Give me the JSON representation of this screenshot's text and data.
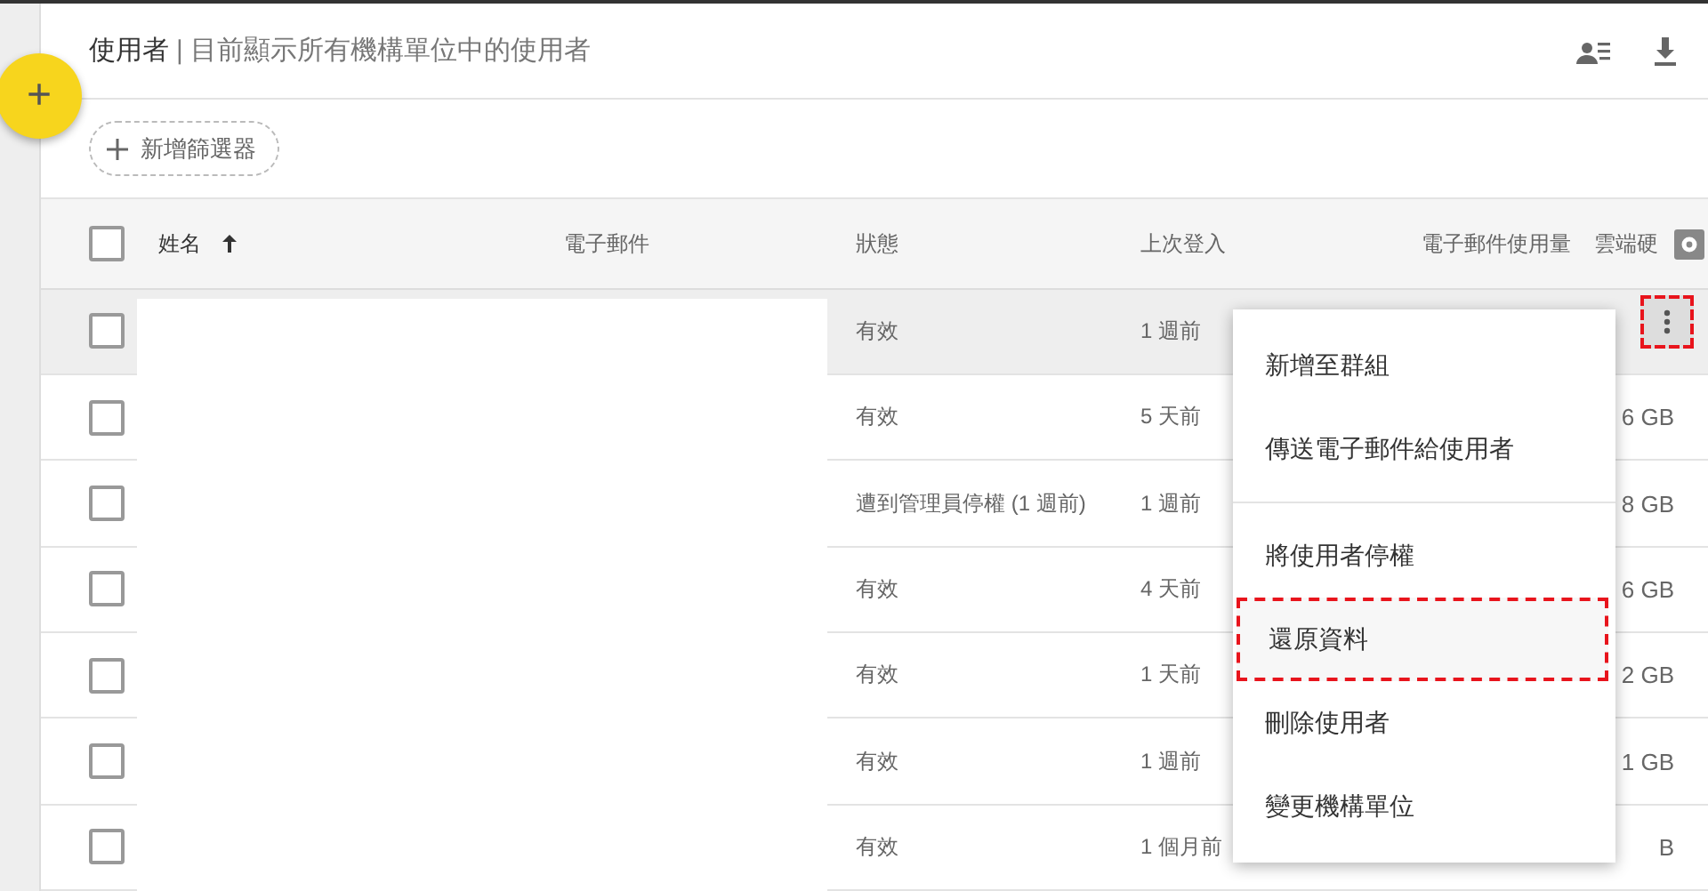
{
  "header": {
    "title": "使用者",
    "subtitle": "| 目前顯示所有機構單位中的使用者"
  },
  "fab": {
    "label": "+"
  },
  "filter": {
    "label": "新增篩選器"
  },
  "table": {
    "all_checked": false,
    "columns": [
      {
        "label": "姓名",
        "sorted": true
      },
      {
        "label": "電子郵件",
        "sorted": false
      },
      {
        "label": "狀態",
        "sorted": false
      },
      {
        "label": "上次登入",
        "sorted": false
      },
      {
        "label": "電子郵件使用量",
        "sorted": false
      },
      {
        "label": "雲端硬",
        "sorted": false
      }
    ],
    "rows": [
      {
        "status": "有效",
        "last_login": "1 週前",
        "drive": "",
        "checked": false,
        "selected": true
      },
      {
        "status": "有效",
        "last_login": "5 天前",
        "drive": "6 GB",
        "checked": false,
        "selected": false
      },
      {
        "status": "遭到管理員停權 (1 週前)",
        "last_login": "1 週前",
        "drive": "8 GB",
        "checked": false,
        "selected": false
      },
      {
        "status": "有效",
        "last_login": "4 天前",
        "drive": "6 GB",
        "checked": false,
        "selected": false
      },
      {
        "status": "有效",
        "last_login": "1 天前",
        "drive": "2 GB",
        "checked": false,
        "selected": false
      },
      {
        "status": "有效",
        "last_login": "1 週前",
        "drive": "1 GB",
        "checked": false,
        "selected": false
      },
      {
        "status": "有效",
        "last_login": "1 個月前",
        "drive": "B",
        "checked": false,
        "selected": false
      }
    ]
  },
  "menu": {
    "items": [
      {
        "label": "新增至群組",
        "divider_after": false,
        "annotated": false
      },
      {
        "label": "傳送電子郵件給使用者",
        "divider_after": true,
        "annotated": false
      },
      {
        "label": "將使用者停權",
        "divider_after": false,
        "annotated": false
      },
      {
        "label": "還原資料",
        "divider_after": false,
        "annotated": true
      },
      {
        "label": "刪除使用者",
        "divider_after": false,
        "annotated": false
      },
      {
        "label": "變更機構單位",
        "divider_after": false,
        "annotated": false
      }
    ]
  },
  "more_button": {
    "annotated": true
  }
}
